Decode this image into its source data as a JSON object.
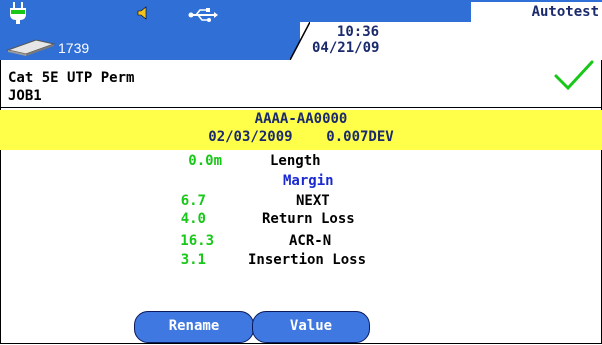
{
  "header": {
    "mode_label": "Autotest",
    "counter": "1739",
    "time": "10:36",
    "date": "04/21/09",
    "icons": [
      "plug-icon",
      "speaker-icon",
      "usb-icon",
      "storage-slab-icon",
      "pass-check-icon"
    ],
    "colors": {
      "header_blue": "#2f6fd6",
      "pass_green": "#18c818",
      "highlight_yellow": "#ffff4a"
    }
  },
  "test": {
    "cable_type": "Cat 5E UTP Perm",
    "job_name": "JOB1",
    "cable_id": "AAAA-AA0000",
    "test_date": "02/03/2009",
    "deviation": "0.007DEV"
  },
  "results": {
    "length": {
      "value": "0.0m",
      "label": "Length"
    },
    "margin_heading": "Margin",
    "rows": [
      {
        "value": "6.7",
        "label": "NEXT"
      },
      {
        "value": "4.0",
        "label": "Return Loss"
      },
      {
        "value": "16.3",
        "label": "ACR-N"
      },
      {
        "value": "3.1",
        "label": "Insertion Loss"
      }
    ]
  },
  "buttons": {
    "rename": "Rename",
    "value": "Value"
  }
}
